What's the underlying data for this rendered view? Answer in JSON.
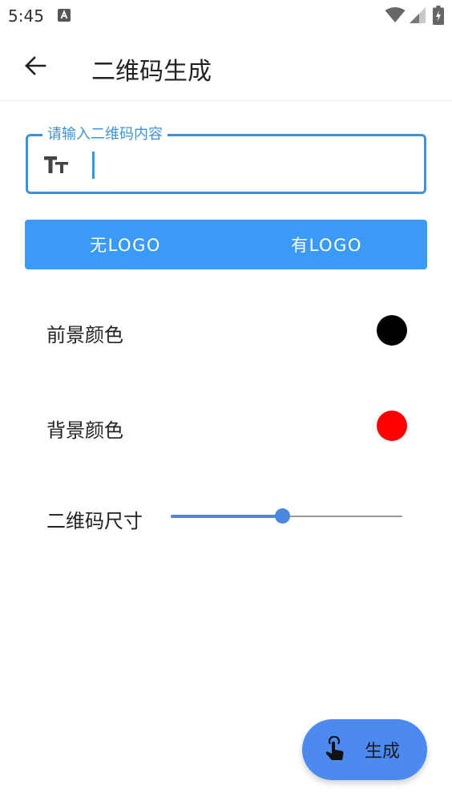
{
  "status_bar": {
    "time": "5:45",
    "notification_icon": "a-box-icon",
    "icons": [
      "wifi-icon",
      "signal-icon",
      "battery-icon"
    ]
  },
  "app_bar": {
    "back_icon": "arrow-left-icon",
    "title": "二维码生成"
  },
  "content_field": {
    "label": "请输入二维码内容",
    "value": "",
    "icon": "text-size-icon",
    "accent_color": "#3d93d8"
  },
  "logo_toggle": {
    "options": [
      "无LOGO",
      "有LOGO"
    ],
    "background_color": "#3a9af5"
  },
  "foreground": {
    "label": "前景颜色",
    "color": "#000000"
  },
  "background": {
    "label": "背景颜色",
    "color": "#ff0000"
  },
  "qr_size": {
    "label": "二维码尺寸",
    "slider_fraction": 0.48
  },
  "generate_button": {
    "icon": "touch-hand-icon",
    "label": "生成",
    "color": "#4d8af0"
  }
}
